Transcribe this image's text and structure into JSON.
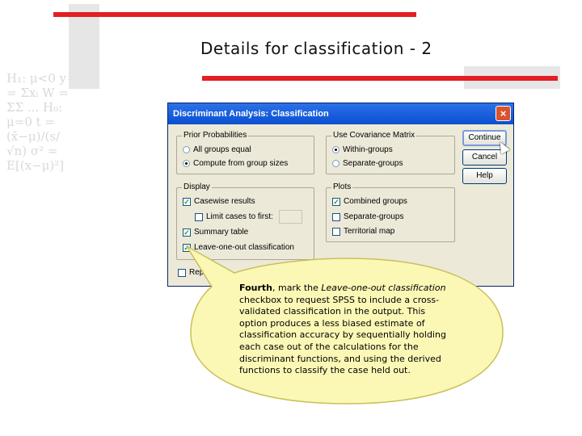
{
  "slide": {
    "title": "Details for classification - 2",
    "decor_formula": "H₁: μ<0  y = Σxᵢ  W = ΣΣ ...  H₀: μ=0  t = (x̄−μ)/(s/√n)  σ² = E[(x−μ)²]"
  },
  "colors": {
    "accent_bar": "#e31e24",
    "callout_fill": "#fbf8b6",
    "titlebar": "#0a4fd0"
  },
  "dialog": {
    "title": "Discriminant Analysis: Classification",
    "close_icon": "×",
    "prior": {
      "legend": "Prior Probabilities",
      "opt1": "All groups equal",
      "opt2": "Compute from group sizes",
      "selected": "Compute from group sizes"
    },
    "covariance": {
      "legend": "Use Covariance Matrix",
      "opt1": "Within-groups",
      "opt2": "Separate-groups",
      "selected": "Within-groups"
    },
    "display": {
      "legend": "Display",
      "casewise": "Casewise results",
      "limit": "Limit cases to first:",
      "summary": "Summary table",
      "loo": "Leave-one-out classification"
    },
    "plots": {
      "legend": "Plots",
      "combined": "Combined groups",
      "separate": "Separate-groups",
      "territorial": "Territorial map"
    },
    "replace_partial": "Rep",
    "buttons": {
      "continue": "Continue",
      "cancel": "Cancel",
      "help": "Help"
    }
  },
  "callout": {
    "lead": "Fourth",
    "t1": ", mark the ",
    "i1": "Leave-one-out classification",
    "t2": " checkbox to request SPSS to include a cross-validated classification in the output.  This option produces a less biased estimate of classification accuracy by sequentially holding each case out of the calculations for the discriminant functions, and using the derived functions to classify the case held out."
  }
}
